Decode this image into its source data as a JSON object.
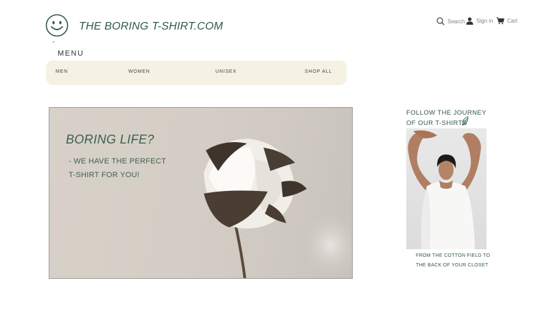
{
  "header": {
    "brand": "THE BORING T-SHIRT.COM",
    "logo_icon": "smiley-face-icon",
    "utility": {
      "search_label": "Search",
      "signin_label": "Sign in",
      "cart_label": "Cart"
    }
  },
  "menu": {
    "label": "MENU",
    "items": [
      {
        "label": "MEN"
      },
      {
        "label": "WOMEN"
      },
      {
        "label": "UNISEX"
      },
      {
        "label": "SHOP ALL"
      }
    ]
  },
  "hero": {
    "title": "BORING LIFE?",
    "subtitle": "- WE HAVE THE PERFECT T-SHIRT FOR YOU!"
  },
  "journey": {
    "title": "FOLLOW THE JOURNEY OF OUR T-SHIRTS",
    "caption": "FROM THE COTTON FIELD TO THE BACK OF YOUR CLOSET"
  },
  "colors": {
    "brand_green": "#2f5a45",
    "nav_background": "#f6f2e3"
  }
}
